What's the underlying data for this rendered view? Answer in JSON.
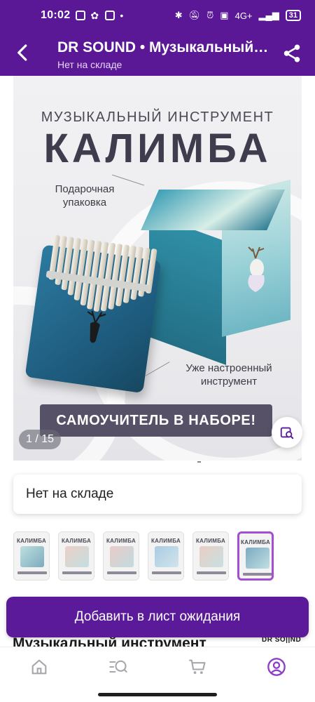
{
  "status_bar": {
    "time": "10:02",
    "network": "4G+",
    "battery": "31"
  },
  "header": {
    "title": "DR SOUND • Музыкальный инструмент калимба",
    "subtitle": "Нет на складе"
  },
  "gallery": {
    "promo_subtitle": "МУЗЫКАЛЬНЫЙ ИНСТРУМЕНТ",
    "promo_title": "КАЛИМБА",
    "gift_label": "Подарочная упаковка",
    "tuned_label": "Уже настроенный инструмент",
    "banner": "САМОУЧИТЕЛЬ В НАБОРЕ!",
    "counter": "1 / 15",
    "thumb_title": "КАЛИМБА",
    "thumbnail_count": 6,
    "selected_thumbnail": 6
  },
  "availability": {
    "text": "Нет на складе"
  },
  "cta": {
    "label": "Добавить в лист ожидания"
  },
  "product": {
    "heading": "Музыкальный инструмент",
    "brand": "DR SO||ND"
  },
  "colors": {
    "brand_purple": "#5a1796",
    "button_purple": "#5b1a99",
    "selected_outline": "#a54ed2"
  },
  "bottom_nav": {
    "items": [
      "home-icon",
      "catalog-search-icon",
      "cart-icon",
      "profile-icon"
    ],
    "active": "profile-icon"
  }
}
